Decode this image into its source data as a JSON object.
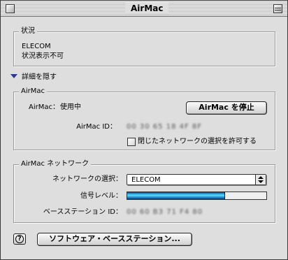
{
  "window": {
    "title": "AirMac"
  },
  "status": {
    "label": "状況",
    "network": "ELECOM",
    "message": "状況表示不可"
  },
  "details": {
    "toggle_label": "詳細を隠す"
  },
  "airmac": {
    "group_label": "AirMac",
    "state_label": "AirMac：",
    "state_value": "使用中",
    "stop_button": "AirMac を停止",
    "id_label": "AirMac ID：",
    "id_value": "00 30 65 18 4F 8F",
    "allow_closed_label": "閉じたネットワークの選択を許可する",
    "allow_closed_checked": false
  },
  "network": {
    "group_label": "AirMac ネットワーク",
    "select_label": "ネットワークの選択：",
    "selected": "ELECOM",
    "signal_label": "信号レベル：",
    "signal_level": 0.7,
    "base_id_label": "ベースステーション ID：",
    "base_id_value": "00 60 B3 71 F4 80"
  },
  "footer": {
    "help_glyph": "?",
    "software_button": "ソフトウェア・ベースステーション..."
  },
  "colors": {
    "window_bg": "#dedede",
    "signal_fill": "#28a9e6",
    "disclosure": "#2a3a8a"
  }
}
